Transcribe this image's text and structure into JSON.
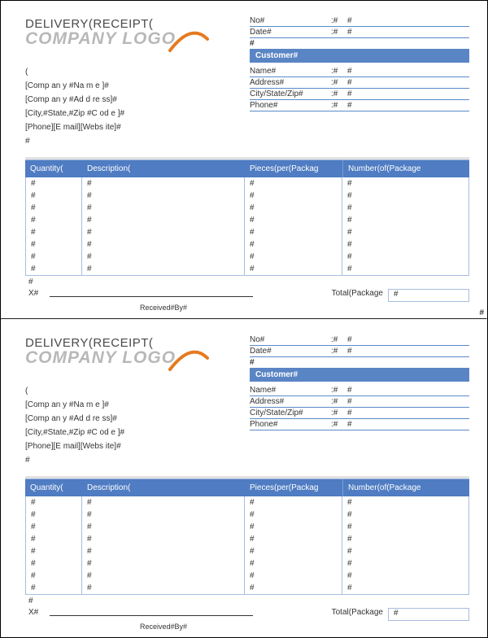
{
  "receipt": {
    "title": "DELIVERY(RECEIPT(",
    "logo_text": "COMPANY LOGO",
    "meta": {
      "no_label": "No#",
      "no_sep": ":#",
      "no_val": "#",
      "date_label": "Date#",
      "date_sep": ":#",
      "date_val": "#",
      "filler": "#"
    },
    "customer": {
      "heading": "Customer#",
      "name_label": "Name#",
      "name_sep": ":#",
      "name_val": "#",
      "address_label": "Address#",
      "address_sep": ":#",
      "address_val": "#",
      "csz_label": "City/State/Zip#",
      "csz_sep": ":#",
      "csz_val": "#",
      "phone_label": "Phone#",
      "phone_sep": ":#",
      "phone_val": "#"
    },
    "company": {
      "paren": "(",
      "name": "[Comp an y #Na m e ]#",
      "address": "[Comp an y #Ad d re ss]#",
      "csz": "[City,#State,#Zip #C od e ]#",
      "contact": "[Phone][E mail][Webs ite]#",
      "filler": "#"
    },
    "table": {
      "headers": {
        "qty": "Quantity(",
        "desc": "Description(",
        "pieces": "Pieces(per(Packag",
        "num": "Number(of(Package"
      },
      "rows": [
        {
          "q": "#",
          "d": "#",
          "p": "#",
          "n": "#"
        },
        {
          "q": "#",
          "d": "#",
          "p": "#",
          "n": "#"
        },
        {
          "q": "#",
          "d": "#",
          "p": "#",
          "n": "#"
        },
        {
          "q": "#",
          "d": "#",
          "p": "#",
          "n": "#"
        },
        {
          "q": "#",
          "d": "#",
          "p": "#",
          "n": "#"
        },
        {
          "q": "#",
          "d": "#",
          "p": "#",
          "n": "#"
        },
        {
          "q": "#",
          "d": "#",
          "p": "#",
          "n": "#"
        },
        {
          "q": "#",
          "d": "#",
          "p": "#",
          "n": "#"
        }
      ]
    },
    "footer": {
      "pre_hash": "#",
      "x": "X#",
      "received_by": "Received#By#",
      "total_label": "Total(Package",
      "total_val": "#"
    }
  },
  "side_hash": "#"
}
